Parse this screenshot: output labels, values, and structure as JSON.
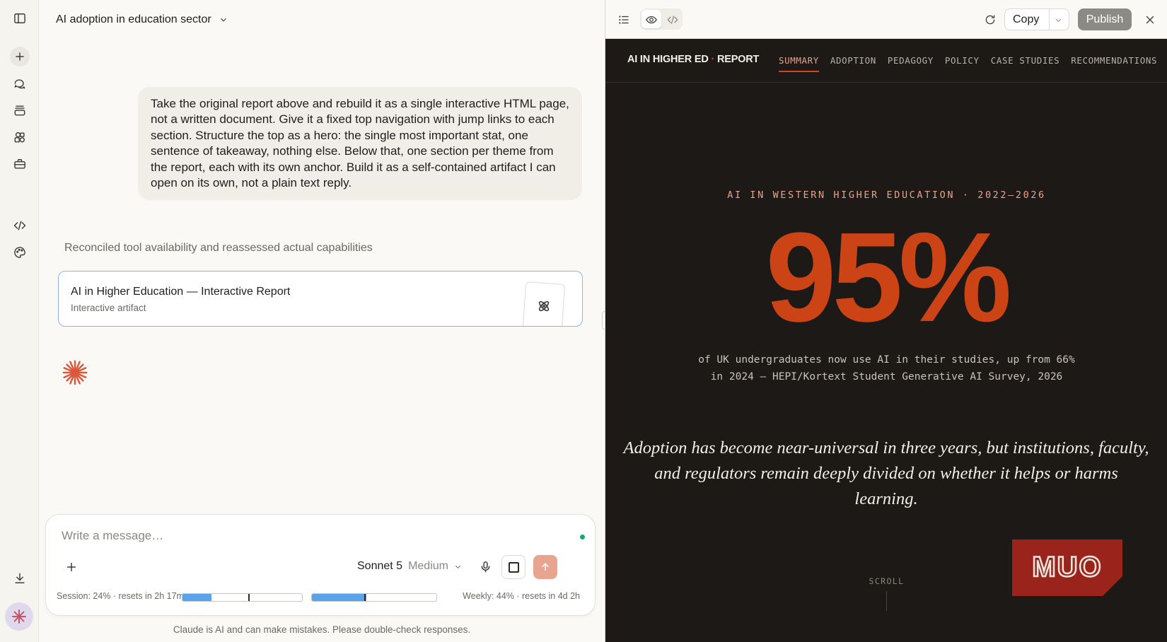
{
  "chat": {
    "title": "AI adoption in education sector",
    "user_message": "Take the original report above and rebuild it as a single interactive HTML page, not a written document. Give it a fixed top navigation with jump links to each section. Structure the top as a hero: the single most important stat, one sentence of takeaway, nothing else. Below that, one section per theme from the report, each with its own anchor. Build it as a self-contained artifact I can open on its own, not a plain text reply.",
    "thinking_status": "Reconciled tool availability and reassessed actual capabilities",
    "artifact_card": {
      "title": "AI in Higher Education — Interactive Report",
      "subtitle": "Interactive artifact"
    }
  },
  "composer": {
    "placeholder": "Write a message…",
    "model": "Sonnet 5",
    "effort": "Medium",
    "session_usage": "Session: 24% · resets in 2h 17m",
    "session_fill": 0.24,
    "session_marker": 0.55,
    "weekly_usage": "Weekly: 44% · resets in 4d 2h",
    "weekly_fill": 0.44,
    "weekly_marker": 0.42
  },
  "footnote": "Claude is AI and can make mistakes. Please double-check responses.",
  "toolbar": {
    "copy_label": "Copy",
    "publish_label": "Publish"
  },
  "report": {
    "brand_main": "AI IN HIGHER ED",
    "brand_sep": "·",
    "brand_tail": "REPORT",
    "nav": [
      "SUMMARY",
      "ADOPTION",
      "PEDAGOGY",
      "POLICY",
      "CASE STUDIES",
      "RECOMMENDATIONS"
    ],
    "kicker": "AI IN WESTERN HIGHER EDUCATION · 2022–2026",
    "stat": "95%",
    "stat_desc": "of UK undergraduates now use AI in their studies, up from 66% in 2024 — HEPI/Kortext Student Generative AI Survey, 2026",
    "takeaway": "Adoption has become near-universal in three years, but institutions, faculty, and regulators remain deeply divided on whether it helps or harms learning.",
    "scroll_label": "SCROLL",
    "watermark": "MUO"
  },
  "colors": {
    "accent": "#cc4416",
    "panel_bg": "#1c1917",
    "kicker": "#e7a28a",
    "usage_bar": "#5aa3ec",
    "send_button": "#e8a48f"
  }
}
